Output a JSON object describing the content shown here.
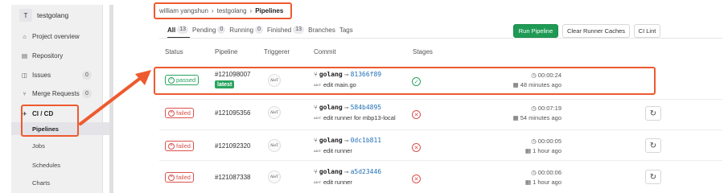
{
  "sidebar": {
    "avatar_letter": "T",
    "project_name": "testgolang",
    "items": [
      {
        "label": "Project overview",
        "icon": "home-icon"
      },
      {
        "label": "Repository",
        "icon": "file-icon"
      },
      {
        "label": "Issues",
        "icon": "issues-icon",
        "badge": "0"
      },
      {
        "label": "Merge Requests",
        "icon": "merge-request-icon",
        "badge": "0"
      },
      {
        "label": "CI / CD",
        "icon": "rocket-icon"
      }
    ],
    "subitems": [
      {
        "label": "Pipelines",
        "active": true
      },
      {
        "label": "Jobs"
      },
      {
        "label": "Schedules"
      },
      {
        "label": "Charts"
      }
    ]
  },
  "breadcrumb": {
    "items": [
      "william yangshun",
      "testgolang",
      "Pipelines"
    ],
    "separator": "›"
  },
  "tabs": [
    {
      "label": "All",
      "count": "13"
    },
    {
      "label": "Pending",
      "count": "0"
    },
    {
      "label": "Running",
      "count": "0"
    },
    {
      "label": "Finished",
      "count": "13"
    },
    {
      "label": "Branches"
    },
    {
      "label": "Tags"
    }
  ],
  "buttons": {
    "run_pipeline": "Run Pipeline",
    "clear_caches": "Clear Runner Caches",
    "ci_lint": "CI Lint"
  },
  "table": {
    "headers": [
      "Status",
      "Pipeline",
      "Triggerer",
      "Commit",
      "Stages"
    ],
    "rows": [
      {
        "status": "passed",
        "status_label": "passed",
        "pipeline": "#121098007",
        "latest": "latest",
        "triggerer": "AleT",
        "branch": "golang",
        "sha": "81366f89",
        "message": "edit main.go",
        "stage": "passed",
        "duration": "00:00:24",
        "finished": "48 minutes ago"
      },
      {
        "status": "failed",
        "status_label": "failed",
        "pipeline": "#121095356",
        "triggerer": "AleT",
        "branch": "golang",
        "sha": "584b4895",
        "message": "edit runner for mbp13-local",
        "stage": "failed",
        "duration": "00:07:19",
        "finished": "54 minutes ago"
      },
      {
        "status": "failed",
        "status_label": "failed",
        "pipeline": "#121092320",
        "triggerer": "AleT",
        "branch": "golang",
        "sha": "0dc1b811",
        "message": "edit runner",
        "stage": "failed",
        "duration": "00:00:05",
        "finished": "1 hour ago"
      },
      {
        "status": "failed",
        "status_label": "failed",
        "pipeline": "#121087338",
        "triggerer": "AleT",
        "branch": "golang",
        "sha": "a5d23446",
        "message": "edit runner",
        "stage": "failed",
        "duration": "00:00:06",
        "finished": "1 hour ago"
      }
    ]
  },
  "colors": {
    "highlight": "#ee5a2f",
    "success": "#2aa35e",
    "danger": "#d9524d",
    "primary_button": "#1f9a54",
    "link": "#1f6fb4"
  }
}
